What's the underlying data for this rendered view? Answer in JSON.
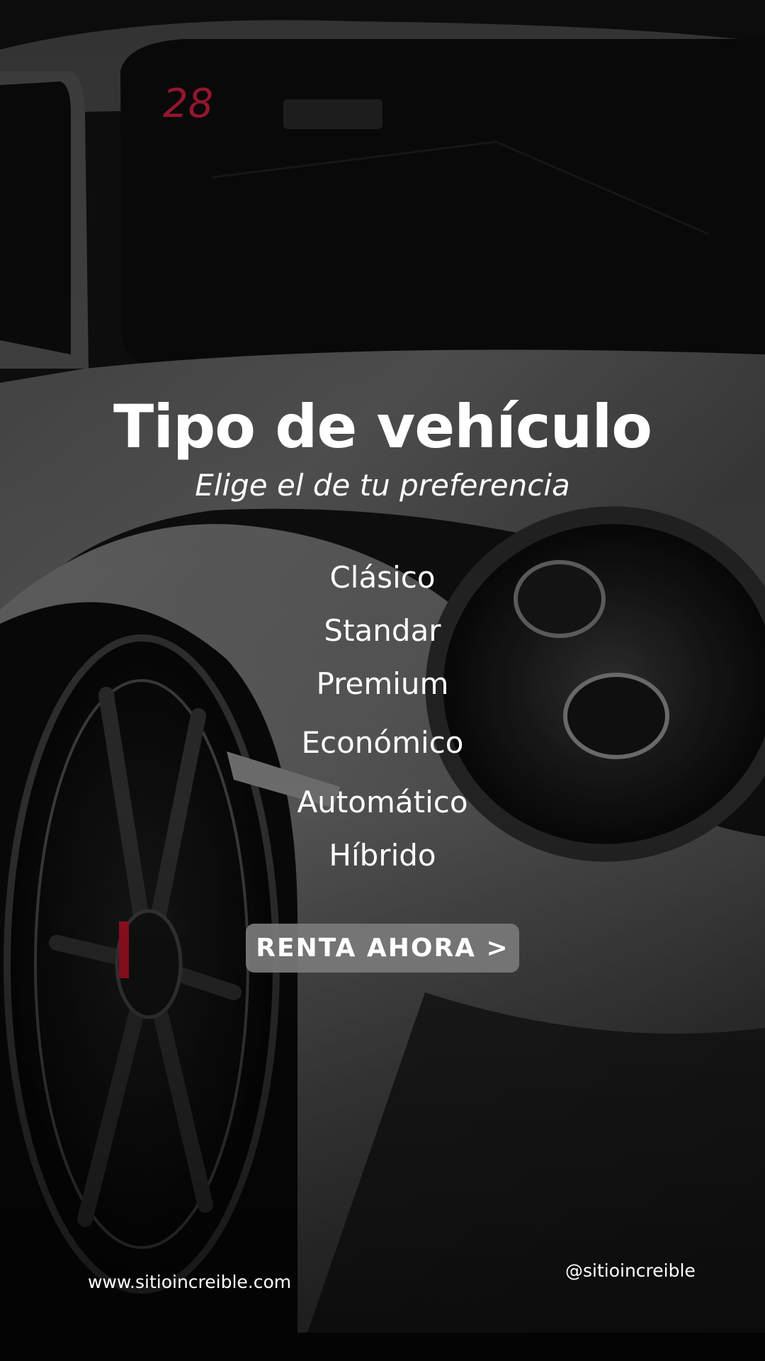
{
  "hero": {
    "title": "Tipo de vehículo",
    "subtitle": "Elige el de tu preferencia"
  },
  "options": [
    {
      "label": "Clásico"
    },
    {
      "label": "Standar"
    },
    {
      "label": "Premium"
    },
    {
      "label": "Económico"
    },
    {
      "label": "Automático"
    },
    {
      "label": "Híbrido"
    }
  ],
  "cta": {
    "label": "RENTA AHORA >"
  },
  "footer": {
    "website": "www.sitioincreible.com",
    "handle": "@sitioincreible"
  },
  "background": {
    "windshield_number": "28"
  },
  "colors": {
    "text": "#ffffff",
    "button": "#7a7a7a",
    "brake_caliper": "#c0142a"
  }
}
